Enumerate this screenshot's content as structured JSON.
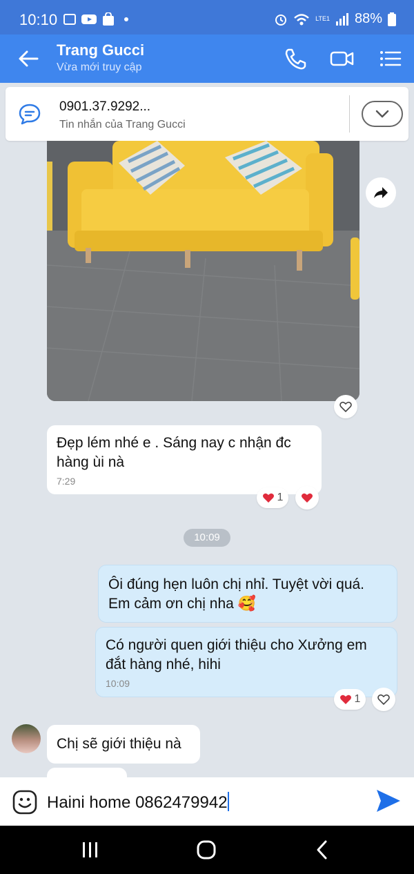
{
  "status_bar": {
    "time": "10:10",
    "battery": "88%",
    "network_label": "LTE1",
    "icons": [
      "gallery-icon",
      "youtube-icon",
      "shopping-icon",
      "alarm-icon",
      "wifi-icon",
      "signal-icon",
      "battery-icon"
    ]
  },
  "header": {
    "contact_name": "Trang Gucci",
    "status": "Vừa mới truy cập",
    "icons": [
      "back-arrow-icon",
      "phone-icon",
      "video-icon",
      "menu-icon"
    ]
  },
  "pinned": {
    "phone": "0901.37.9292...",
    "description": "Tin nhắn của Trang Gucci"
  },
  "messages": [
    {
      "direction": "in",
      "text": "Đẹp lém nhé e . Sáng nay c nhận đc hàng ùi nà",
      "time": "7:29",
      "reaction_count": "1"
    },
    {
      "direction": "out",
      "text": "Ôi đúng hẹn luôn chị nhỉ. Tuyệt vời quá. Em cảm ơn chị nha 🥰"
    },
    {
      "direction": "out",
      "text": "Có người quen giới thiệu cho Xưởng em đắt hàng nhé, hihi",
      "time": "10:09",
      "reaction_count": "1"
    },
    {
      "direction": "in",
      "text": "Chị sẽ giới thiệu nà"
    }
  ],
  "time_divider": "10:09",
  "composer": {
    "text": "Haini home 0862479942"
  },
  "colors": {
    "header": "#3f86ee",
    "status_bar": "#3f78d8",
    "outgoing_bubble": "#d6ecfb",
    "background": "#dfe4ea",
    "heart": "#e02b3c",
    "send": "#1e6fe8"
  }
}
